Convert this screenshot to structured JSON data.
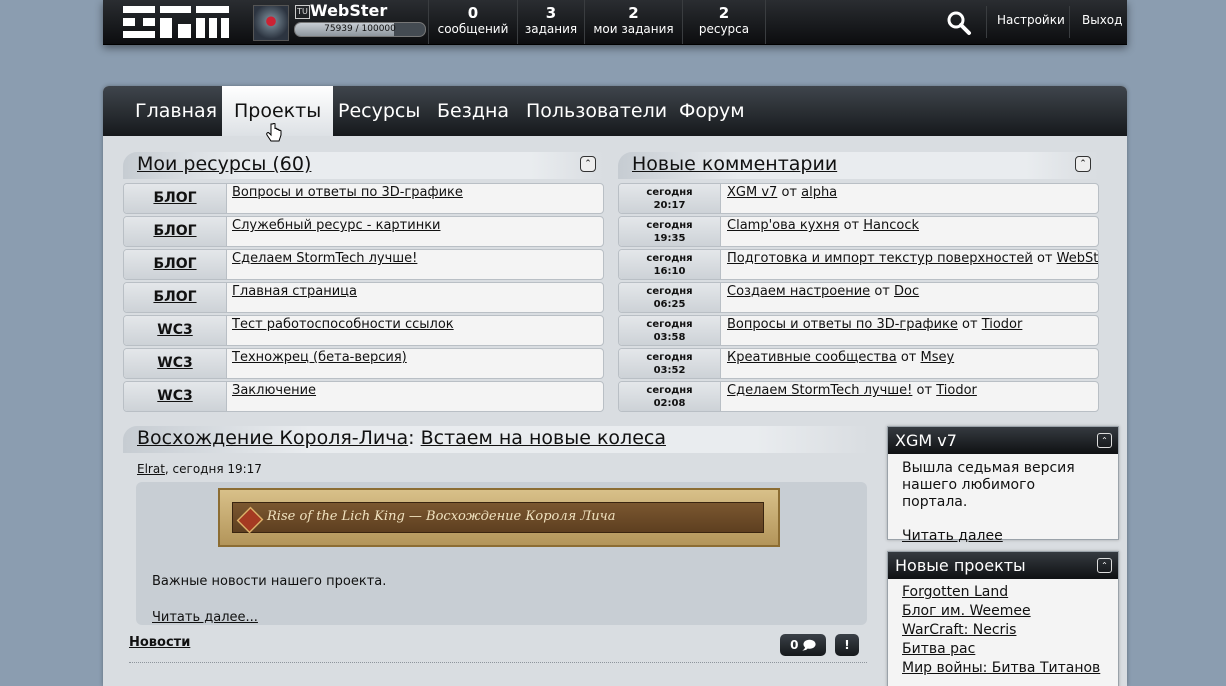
{
  "topbar": {
    "username": "WebSter",
    "user_badge": "TU",
    "xp": "75939 / 100000",
    "xp_progress": 0.759,
    "stats": [
      {
        "num": "0",
        "label": "сообщений"
      },
      {
        "num": "3",
        "label": "задания"
      },
      {
        "num": "2",
        "label": "мои задания"
      },
      {
        "num": "2",
        "label": "ресурса"
      }
    ],
    "settings": "Настройки",
    "logout": "Выход"
  },
  "nav": [
    "Главная",
    "Проекты",
    "Ресурсы",
    "Бездна",
    "Пользователи",
    "Форум"
  ],
  "my_resources": {
    "title": "Мои ресурсы (60)",
    "collapse_glyph": "⌃",
    "rows": [
      {
        "tag": "БЛОГ",
        "text": "Вопросы и ответы по 3D-графике"
      },
      {
        "tag": "БЛОГ",
        "text": "Служебный ресурс - картинки"
      },
      {
        "tag": "БЛОГ",
        "text": "Сделаем StormTech лучше!"
      },
      {
        "tag": "БЛОГ",
        "text": "Главная страница"
      },
      {
        "tag": "WC3",
        "text": "Тест работоспособности ссылок"
      },
      {
        "tag": "WC3",
        "text": "Техножрец (бета-версия)"
      },
      {
        "tag": "WC3",
        "text": "Заключение"
      }
    ]
  },
  "new_comments": {
    "title": "Новые комментарии",
    "collapse_glyph": "⌃",
    "from_word": "от",
    "rows": [
      {
        "day": "сегодня",
        "time": "20:17",
        "topic": "XGM v7",
        "author": "alpha"
      },
      {
        "day": "сегодня",
        "time": "19:35",
        "topic": "Clamp'ова кухня",
        "author": "Hancock"
      },
      {
        "day": "сегодня",
        "time": "16:10",
        "topic": "Подготовка и импорт текстур поверхностей",
        "author": "WebSter"
      },
      {
        "day": "сегодня",
        "time": "06:25",
        "topic": "Создаем настроение",
        "author": "Doc"
      },
      {
        "day": "сегодня",
        "time": "03:58",
        "topic": "Вопросы и ответы по 3D-графике",
        "author": "Tiodor"
      },
      {
        "day": "сегодня",
        "time": "03:52",
        "topic": "Креативные сообщества",
        "author": "Msey"
      },
      {
        "day": "сегодня",
        "time": "02:08",
        "topic": "Сделаем StormTech лучше!",
        "author": "Tiodor"
      }
    ]
  },
  "article": {
    "project": "Восхождение Короля-Лича",
    "separator": ":",
    "title": "Встаем на новые колеса",
    "author": "Elrat",
    "date": ", сегодня 19:17",
    "banner_text": "Rise of the Lich King — Восхождение Короля Лича",
    "body": "Важные новости нашего проекта.",
    "read_more": "Читать далее...",
    "category": "Новости",
    "comments_count": "0",
    "report_label": "!"
  },
  "xgm_box": {
    "title": "XGM v7",
    "collapse_glyph": "⌃",
    "text": "Вышла седьмая версия нашего любимого портала.",
    "read_more": "Читать далее"
  },
  "new_projects": {
    "title": "Новые проекты",
    "collapse_glyph": "⌃",
    "items": [
      "Forgotten Land",
      "Блог им. Weemee",
      "WarCraft: Necris",
      "Битва рас",
      "Мир войны: Битва Титанов"
    ]
  }
}
